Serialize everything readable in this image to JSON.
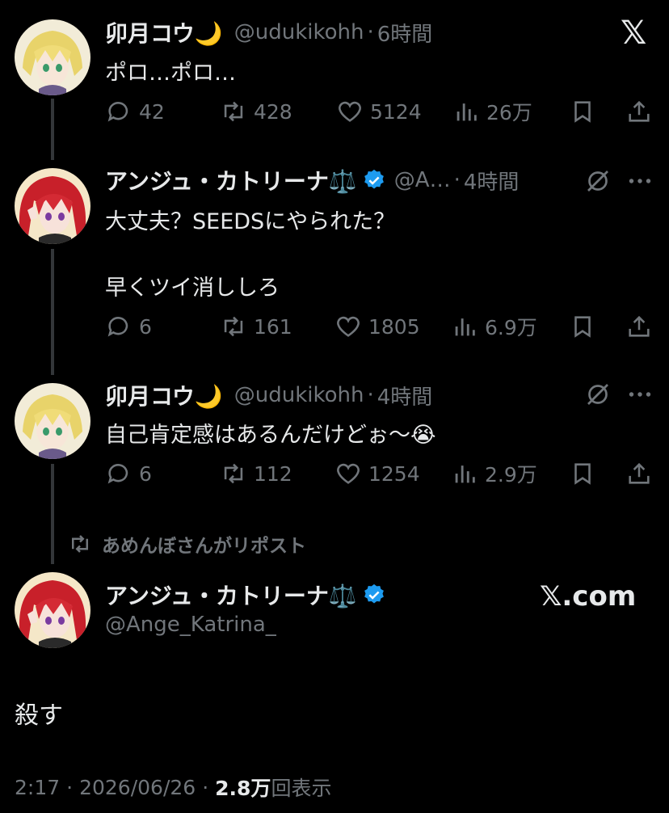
{
  "tweets": [
    {
      "name": "卯月コウ🌙",
      "handle": "@udukikohh",
      "time": "6時間",
      "text": [
        "ポロ…ポロ…"
      ],
      "replies": "42",
      "reposts": "428",
      "likes": "5124",
      "views": "26万"
    },
    {
      "name": "アンジュ・カトリーナ⚖️",
      "handle": "@A…",
      "time": "4時間",
      "text": [
        "大丈夫？SEEDSにやられた？",
        "早くツイ消ししろ"
      ],
      "replies": "6",
      "reposts": "161",
      "likes": "1805",
      "views": "6.9万"
    },
    {
      "name": "卯月コウ🌙",
      "handle": "@udukikohh",
      "time": "4時間",
      "text": [
        "自己肯定感はあるんだけどぉ〜😭"
      ],
      "replies": "6",
      "reposts": "112",
      "likes": "1254",
      "views": "2.9万"
    }
  ],
  "repost_notice": "あめんぼさんがリポスト",
  "main_tweet": {
    "name": "アンジュ・カトリーナ⚖️",
    "handle": "@Ange_Katrina_",
    "text": "殺す",
    "time": "2:17",
    "date": "2026/06/26",
    "views_count": "2.8万",
    "views_label": "回表示"
  },
  "branding": {
    "logo": "𝕏",
    "watermark": "𝕏.com"
  },
  "separator": "·",
  "icons": {
    "reply": "reply-icon",
    "repost": "repost-icon",
    "like": "like-icon",
    "views": "views-icon",
    "bookmark": "bookmark-icon",
    "share": "share-icon",
    "grok": "grok-icon",
    "more": "more-icon",
    "verified": "verified-badge-icon"
  },
  "colors": {
    "background": "#000000",
    "text": "#e7e9ea",
    "muted": "#71767b",
    "verified": "#1d9bf0"
  }
}
